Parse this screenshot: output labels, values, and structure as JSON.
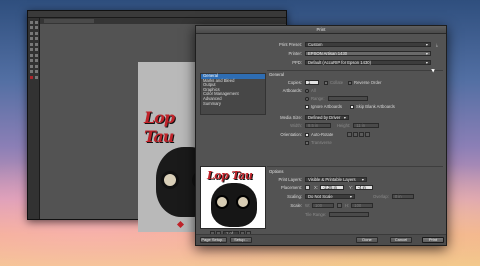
{
  "dialog": {
    "title": "Print",
    "print_preset_label": "Print Preset:",
    "print_preset_value": "Custom",
    "printer_label": "Printer:",
    "printer_value": "EPSON Artisan 1430",
    "ppd_label": "PPD:",
    "ppd_value": "Default (AccuRIP for Epson 1430)"
  },
  "categories": [
    "General",
    "Marks and Bleed",
    "Output",
    "Graphics",
    "Color Management",
    "Advanced",
    "Summary"
  ],
  "general": {
    "section_label": "General",
    "copies_label": "Copies:",
    "copies_value": "1",
    "collate_label": "Collate",
    "reverse_order_label": "Reverse Order",
    "artboards_label": "Artboards:",
    "all_label": "All",
    "range_label": "Range:",
    "ignore_artboards_label": "Ignore Artboards",
    "skip_blank_label": "Skip Blank Artboards",
    "media_size_label": "Media Size:",
    "media_size_value": "Defined by Driver",
    "width_label": "Width:",
    "width_value": "8.5 in",
    "height_label": "Height:",
    "height_value": "11 in",
    "orientation_label": "Orientation:",
    "auto_rotate_label": "Auto-Rotate",
    "transverse_label": "Transverse"
  },
  "options": {
    "section_label": "Options",
    "print_layers_label": "Print Layers:",
    "print_layers_value": "Visible & Printable Layers",
    "placement_label": "Placement:",
    "placement_x_label": "X:",
    "placement_x_value": "-2.25 in",
    "placement_y_label": "Y:",
    "placement_y_value": "-4 in",
    "scaling_label": "Scaling:",
    "scaling_value": "Do Not Scale",
    "overlap_label": "Overlap:",
    "overlap_value": "0 in",
    "scale_label": "Scale:",
    "scale_w_label": "W:",
    "scale_w_value": "100",
    "scale_h_label": "H:",
    "scale_h_value": "100",
    "tile_range_label": "Tile Range:"
  },
  "preview": {
    "nav_value": "1 of 1",
    "document_info": "Document: 11 in x 16 in",
    "media_info": "Media: 8.5 in x 11 in",
    "logo_text": "Lop Tau"
  },
  "artwork_logo_text": "Lop Tau",
  "footer": {
    "page_setup_label": "Page Setup...",
    "setup_label": "Setup...",
    "done_label": "Done",
    "cancel_label": "Cancel",
    "print_label": "Print"
  },
  "colors": {
    "accent_red": "#c0232a",
    "selection_blue": "#2e6db3"
  }
}
